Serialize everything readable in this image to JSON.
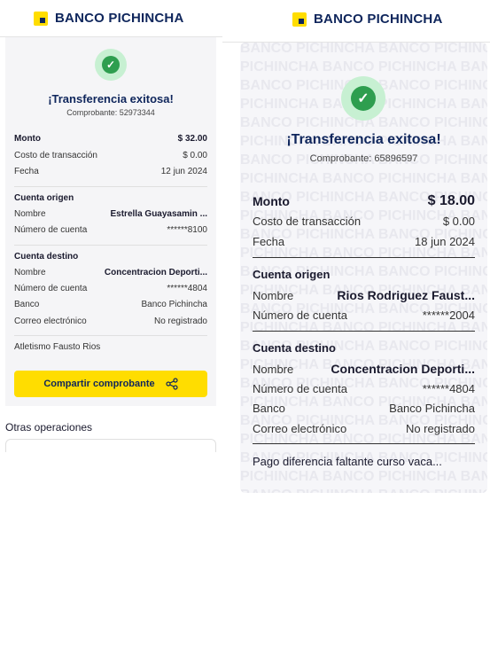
{
  "brand": "BANCO PICHINCHA",
  "left": {
    "title": "¡Transferencia exitosa!",
    "receipt": "Comprobante: 52973344",
    "summary": [
      {
        "label": "Monto",
        "value": "$ 32.00"
      },
      {
        "label": "Costo de transacción",
        "value": "$ 0.00"
      },
      {
        "label": "Fecha",
        "value": "12 jun 2024"
      }
    ],
    "origin_title": "Cuenta origen",
    "origin": [
      {
        "label": "Nombre",
        "value": "Estrella  Guayasamin ..."
      },
      {
        "label": "Número de cuenta",
        "value": "******8100"
      }
    ],
    "dest_title": "Cuenta destino",
    "dest": [
      {
        "label": "Nombre",
        "value": "Concentracion Deporti..."
      },
      {
        "label": "Número de cuenta",
        "value": "******4804"
      },
      {
        "label": "Banco",
        "value": "Banco Pichincha"
      },
      {
        "label": "Correo electrónico",
        "value": "No registrado"
      }
    ],
    "note": "Atletismo Fausto Rios",
    "share_button": "Compartir comprobante",
    "other_ops": "Otras operaciones"
  },
  "right": {
    "title": "¡Transferencia exitosa!",
    "receipt": "Comprobante: 65896597",
    "summary": [
      {
        "label": "Monto",
        "value": "$ 18.00"
      },
      {
        "label": "Costo de transacción",
        "value": "$ 0.00"
      },
      {
        "label": "Fecha",
        "value": "18 jun 2024"
      }
    ],
    "origin_title": "Cuenta origen",
    "origin": [
      {
        "label": "Nombre",
        "value": "Rios  Rodriguez Faust..."
      },
      {
        "label": "Número de cuenta",
        "value": "******2004"
      }
    ],
    "dest_title": "Cuenta destino",
    "dest": [
      {
        "label": "Nombre",
        "value": "Concentracion Deporti..."
      },
      {
        "label": "Número de cuenta",
        "value": "******4804"
      },
      {
        "label": "Banco",
        "value": "Banco Pichincha"
      },
      {
        "label": "Correo electrónico",
        "value": "No registrado"
      }
    ],
    "note": "Pago diferencia faltante curso vaca...",
    "watermark": "BANCO PICHINCHA"
  }
}
